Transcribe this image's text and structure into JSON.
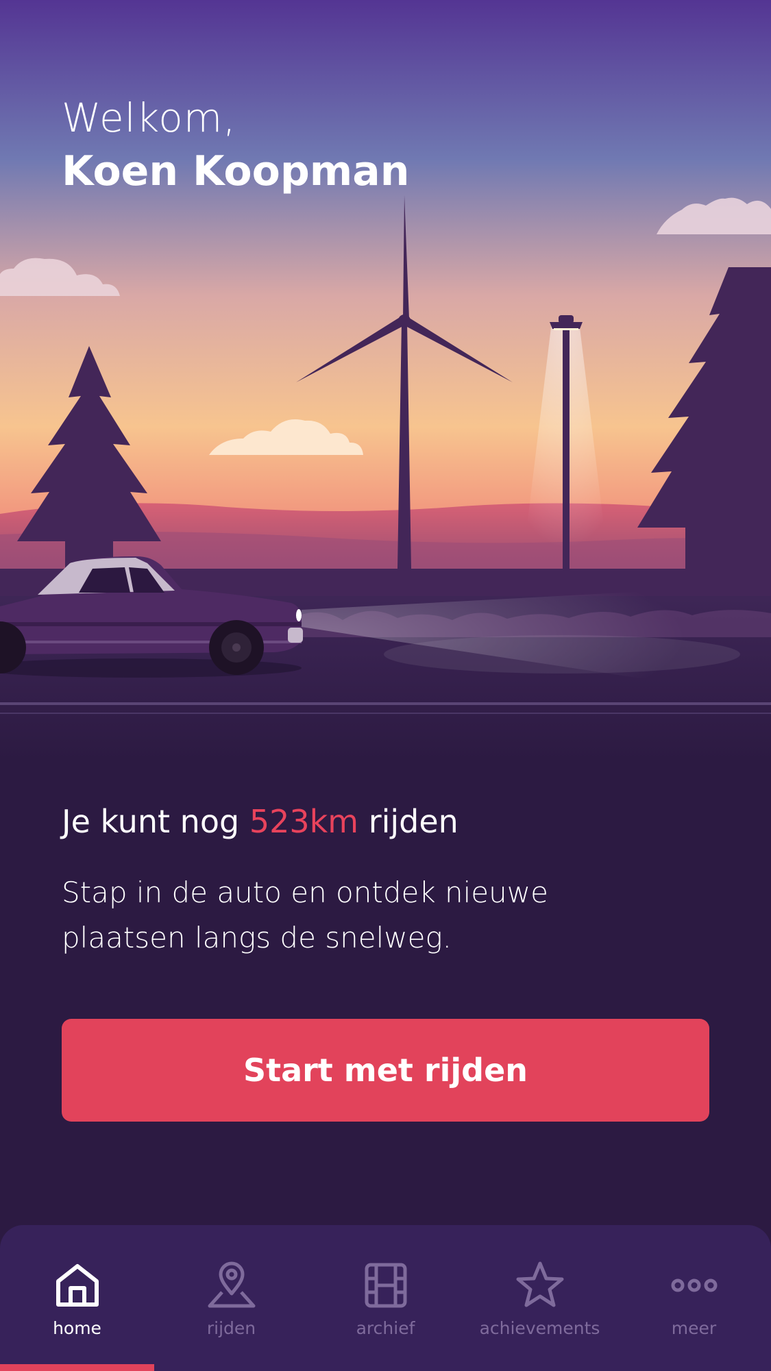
{
  "greeting": {
    "welcome": "Welkom,",
    "user_name": "Koen Koopman"
  },
  "range": {
    "prefix": "Je kunt nog",
    "distance": "523km",
    "suffix": "rijden"
  },
  "description": "Stap in de auto en ontdek nieuwe plaatsen langs de snelweg.",
  "cta_label": "Start met rijden",
  "tabbar": {
    "active": "home",
    "items": [
      {
        "id": "home",
        "label": "home",
        "icon": "home-icon"
      },
      {
        "id": "rijden",
        "label": "rijden",
        "icon": "map-pin-icon"
      },
      {
        "id": "archief",
        "label": "archief",
        "icon": "film-icon"
      },
      {
        "id": "achievements",
        "label": "achievements",
        "icon": "star-icon"
      },
      {
        "id": "meer",
        "label": "meer",
        "icon": "more-icon"
      }
    ]
  },
  "colors": {
    "accent": "#e2435b",
    "background": "#2c1a42",
    "tabbar": "#37225a",
    "tab_inactive": "#7f6b9c"
  }
}
